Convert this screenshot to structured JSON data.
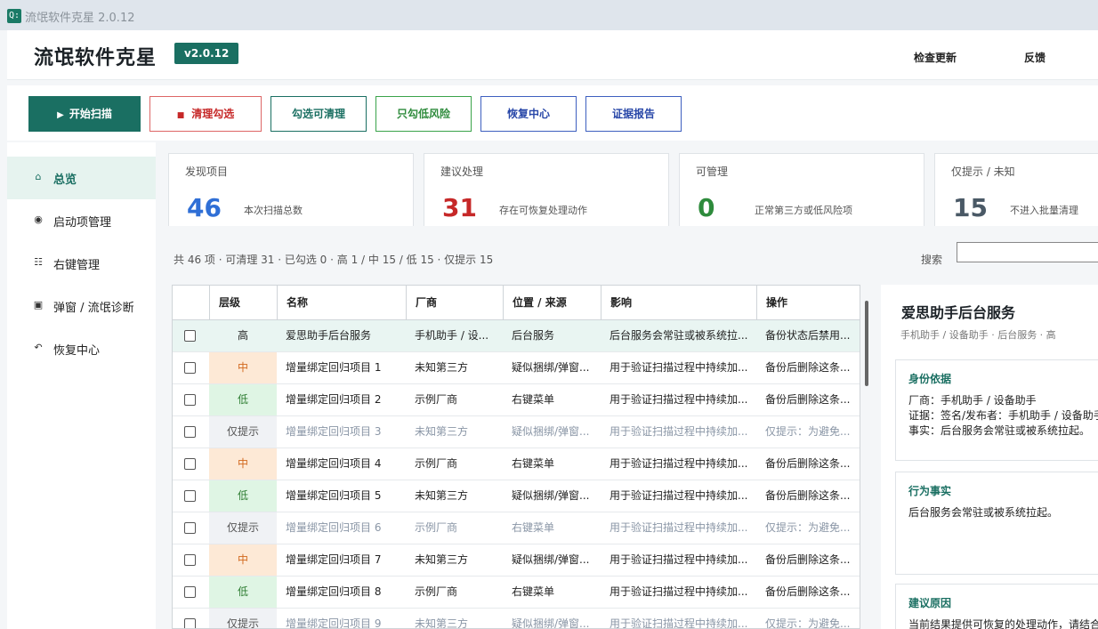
{
  "window": {
    "title": "流氓软件克星 2.0.12",
    "icon": "app-logo-icon"
  },
  "header": {
    "brand": "流氓软件克星",
    "version": "v2.0.12",
    "check_update": "检查更新",
    "feedback": "反馈"
  },
  "toolbar": {
    "start_scan": "开始扫描",
    "clean_checked": "清理勾选",
    "check_cleanable": "勾选可清理",
    "check_low_risk": "只勾低风险",
    "recovery_center": "恢复中心",
    "evidence_report": "证据报告"
  },
  "sidebar": {
    "items": [
      {
        "label": "总览",
        "icon": "home-icon",
        "active": true
      },
      {
        "label": "启动项管理",
        "icon": "radio-dot-icon",
        "active": false
      },
      {
        "label": "右键管理",
        "icon": "list-icon",
        "active": false
      },
      {
        "label": "弹窗 / 流氓诊断",
        "icon": "popup-square-icon",
        "active": false
      },
      {
        "label": "恢复中心",
        "icon": "restore-arrow-icon",
        "active": false
      }
    ]
  },
  "stats": [
    {
      "label": "发现项目",
      "value": "46",
      "desc": "本次扫描总数",
      "color": "#2f6fd6"
    },
    {
      "label": "建议处理",
      "value": "31",
      "desc": "存在可恢复处理动作",
      "color": "#c62828"
    },
    {
      "label": "可管理",
      "value": "0",
      "desc": "正常第三方或低风险项",
      "color": "#2e8b3c"
    },
    {
      "label": "仅提示 / 未知",
      "value": "15",
      "desc": "不进入批量清理",
      "color": "#4a5966"
    }
  ],
  "summary": "共 46 项 · 可清理 31 · 已勾选 0 · 高 1 / 中 15 / 低 15 · 仅提示 15",
  "search": {
    "label": "搜索",
    "value": ""
  },
  "table": {
    "columns": [
      "层级",
      "名称",
      "厂商",
      "位置 / 来源",
      "影响",
      "操作"
    ],
    "rows": [
      {
        "level": "高",
        "name": "爱思助手后台服务",
        "vendor": "手机助手 / 设...",
        "source": "后台服务",
        "impact": "后台服务会常驻或被系统拉...",
        "action": "备份状态后禁用..."
      },
      {
        "level": "中",
        "name": "增量绑定回归项目 1",
        "vendor": "未知第三方",
        "source": "疑似捆绑/弹窗...",
        "impact": "用于验证扫描过程中持续加...",
        "action": "备份后删除这条..."
      },
      {
        "level": "低",
        "name": "增量绑定回归项目 2",
        "vendor": "示例厂商",
        "source": "右键菜单",
        "impact": "用于验证扫描过程中持续加...",
        "action": "备份后删除这条..."
      },
      {
        "level": "仅提示",
        "name": "增量绑定回归项目 3",
        "vendor": "未知第三方",
        "source": "疑似捆绑/弹窗...",
        "impact": "用于验证扫描过程中持续加...",
        "action": "仅提示：为避免..."
      },
      {
        "level": "中",
        "name": "增量绑定回归项目 4",
        "vendor": "示例厂商",
        "source": "右键菜单",
        "impact": "用于验证扫描过程中持续加...",
        "action": "备份后删除这条..."
      },
      {
        "level": "低",
        "name": "增量绑定回归项目 5",
        "vendor": "未知第三方",
        "source": "疑似捆绑/弹窗...",
        "impact": "用于验证扫描过程中持续加...",
        "action": "备份后删除这条..."
      },
      {
        "level": "仅提示",
        "name": "增量绑定回归项目 6",
        "vendor": "示例厂商",
        "source": "右键菜单",
        "impact": "用于验证扫描过程中持续加...",
        "action": "仅提示：为避免..."
      },
      {
        "level": "中",
        "name": "增量绑定回归项目 7",
        "vendor": "未知第三方",
        "source": "疑似捆绑/弹窗...",
        "impact": "用于验证扫描过程中持续加...",
        "action": "备份后删除这条..."
      },
      {
        "level": "低",
        "name": "增量绑定回归项目 8",
        "vendor": "示例厂商",
        "source": "右键菜单",
        "impact": "用于验证扫描过程中持续加...",
        "action": "备份后删除这条..."
      },
      {
        "level": "仅提示",
        "name": "增量绑定回归项目 9",
        "vendor": "未知第三方",
        "source": "疑似捆绑/弹窗...",
        "impact": "用于验证扫描过程中持续加...",
        "action": "仅提示：为避免..."
      }
    ]
  },
  "detail": {
    "title": "爱思助手后台服务",
    "subtitle": "手机助手 / 设备助手 · 后台服务 · 高",
    "identity": {
      "title": "身份依据",
      "lines": [
        "厂商：手机助手 / 设备助手",
        "证据：签名/发布者：手机助手 / 设备助手",
        "事实：后台服务会常驻或被系统拉起。"
      ]
    },
    "behavior": {
      "title": "行为事实",
      "lines": [
        "后台服务会常驻或被系统拉起。"
      ]
    },
    "reason": {
      "title": "建议原因",
      "lines": [
        "当前结果提供可恢复的处理动作，请结合"
      ]
    }
  }
}
